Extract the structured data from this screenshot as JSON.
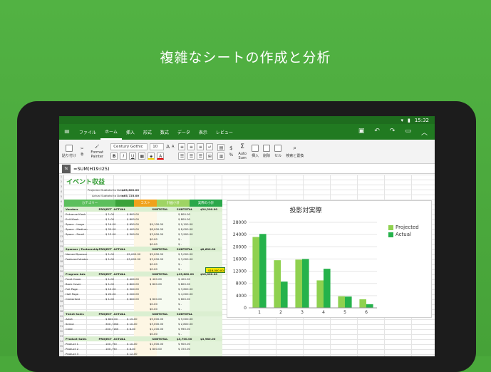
{
  "headline": "複雑なシートの作成と分析",
  "status": {
    "time": "15:32",
    "wifi": "wifi-icon",
    "battery": "battery-icon"
  },
  "ribbon": {
    "tabs": [
      "ファイル",
      "ホーム",
      "挿入",
      "形式",
      "数式",
      "データ",
      "表示",
      "レビュー"
    ],
    "active_tab": "ホーム"
  },
  "toolbar": {
    "paste": "貼り付け",
    "format_painter": "Format Painter",
    "font_name": "Century Gothic",
    "font_size": "10",
    "auto_sum": "Auto Sum",
    "insert": "挿入",
    "delete": "削除",
    "cell": "セル",
    "find_replace": "検索と置換"
  },
  "formula": {
    "fx": "fx",
    "value": "=SUM(H19:I25)"
  },
  "sheet": {
    "title": "イベント収益",
    "projected_label": "Projected Subtotal to Date:",
    "projected_value": "$63,800.00",
    "actual_label": "Actual Subtotal to Date:",
    "actual_value": "$65,725.00",
    "header_band": [
      "カテゴリー",
      "",
      "コスト",
      "計画小計",
      "実際の小計"
    ],
    "sections": [
      {
        "name": "Vendors",
        "cols": [
          "PROJECTED",
          "ACTUAL",
          "",
          "SUBTOTAL",
          "SUBTOTAL",
          "$24,200.00"
        ],
        "rows": [
          [
            "Entrance Kiosk",
            "$ 1.00",
            "$ 800.00",
            "",
            "$ 800.00"
          ],
          [
            "Exit Kiosk",
            "$ 1.00",
            "$ 800.00",
            "",
            "$ 800.00"
          ],
          [
            "Space - Large",
            "$ 14.00",
            "$ 650.00",
            "$9,100.00",
            "$ 9,100.00"
          ],
          [
            "Space - Medium",
            "$ 20.00",
            "$ 400.00",
            "$8,000.00",
            "$ 8,000.00"
          ],
          [
            "Space - Small",
            "$ 13.00",
            "$ 300.00",
            "$3,900.00",
            "$ 3,900.00"
          ],
          [
            "",
            "",
            "",
            "$0.00",
            "$ -"
          ],
          [
            "",
            "",
            "",
            "$0.00",
            "$ -"
          ]
        ]
      },
      {
        "name": "Sponsor / Partnerships",
        "cols": [
          "PROJECTED",
          "ACTUAL",
          "",
          "SUBTOTAL",
          "SUBTOTAL",
          "$8,600.00"
        ],
        "rows": [
          [
            "Named Sponsor",
            "$ 1.00",
            "$5,000.00",
            "$5,000.00",
            "$ 5,000.00"
          ],
          [
            "Featured Vendor",
            "$ 1.00",
            "$3,000.00",
            "$3,000.00",
            "$ 3,000.00"
          ],
          [
            "",
            "",
            "",
            "$0.00",
            "$ -"
          ],
          [
            "",
            "",
            "",
            "$0.00",
            "$ -"
          ]
        ]
      },
      {
        "name": "Program Ads",
        "cols": [
          "PROJECTED",
          "ACTUAL",
          "",
          "SUBTOTAL",
          "$15,800.00",
          "$16,000.00"
        ],
        "rows": [
          [
            "Front Cover",
            "$ 1.00",
            "$ 400.00",
            "$ 400.00",
            "$ 400.00"
          ],
          [
            "Back Cover",
            "$ 1.00",
            "$ 800.00",
            "$ 800.00",
            "$ 800.00"
          ],
          [
            "Full Page",
            "$ 12.00",
            "$ 300.00",
            "",
            "$ 3,600.00"
          ],
          [
            "Half Page",
            "$ 20.00",
            "$ 200.00",
            "",
            "$ 4,000.00"
          ],
          [
            "Centerfold",
            "$ 1.00",
            "$ 600.00",
            "$ 600.00",
            "$ 600.00"
          ],
          [
            "",
            "",
            "",
            "$0.00",
            "$ -"
          ],
          [
            "",
            "",
            "",
            "$0.00",
            "$ -"
          ]
        ]
      },
      {
        "name": "Ticket Sales",
        "cols": [
          "PROJECTED",
          "ACTUAL",
          "",
          "SUBTOTAL",
          "SUBTOTAL",
          ""
        ],
        "rows": [
          [
            "Adult",
            "$ 600.00",
            "$ 15.00",
            "$9,000.00",
            "$ 9,000.00"
          ],
          [
            "Senior",
            "300 / 280",
            "$ 10.00",
            "$3,000.00",
            "$ 2,800.00"
          ],
          [
            "Child",
            "200 / 165",
            "$ 6.00",
            "$1,200.00",
            "$ 990.00"
          ],
          [
            "",
            "",
            "",
            "$0.00",
            "$ -"
          ]
        ]
      },
      {
        "name": "Product Sales",
        "cols": [
          "PROJECTED",
          "ACTUAL",
          "",
          "SUBTOTAL",
          "$3,700.00",
          "$3,980.00"
        ],
        "rows": [
          [
            "Product 1",
            "100 / 90",
            "$ 10.00",
            "$1,000.00",
            "$ 900.00"
          ],
          [
            "Product 2",
            "100 / 90",
            "$ 8.00",
            "$ 800.00",
            "$ 720.00"
          ],
          [
            "Product 3",
            "",
            "$ 12.00",
            "",
            ""
          ]
        ]
      }
    ],
    "selected_value": "$16,000.00"
  },
  "chart_data": {
    "type": "bar",
    "title": "投影対実際",
    "categories": [
      "1",
      "2",
      "3",
      "4",
      "5",
      "6"
    ],
    "series": [
      {
        "name": "Projected",
        "values": [
          23200,
          15600,
          15800,
          9000,
          3800,
          2800
        ]
      },
      {
        "name": "Actual",
        "values": [
          24200,
          8600,
          16000,
          12800,
          3700,
          1200
        ]
      }
    ],
    "ylim": [
      0,
      28000
    ],
    "yticks": [
      "0",
      "4000",
      "8000",
      "12000",
      "16000",
      "20000",
      "24000",
      "28000"
    ],
    "legend_position": "right",
    "colors": {
      "Projected": "#8fd14f",
      "Actual": "#25b24b"
    }
  },
  "colors": {
    "brand": "#217a21",
    "background": "#4aa93b",
    "band": "#5cbf5c"
  }
}
